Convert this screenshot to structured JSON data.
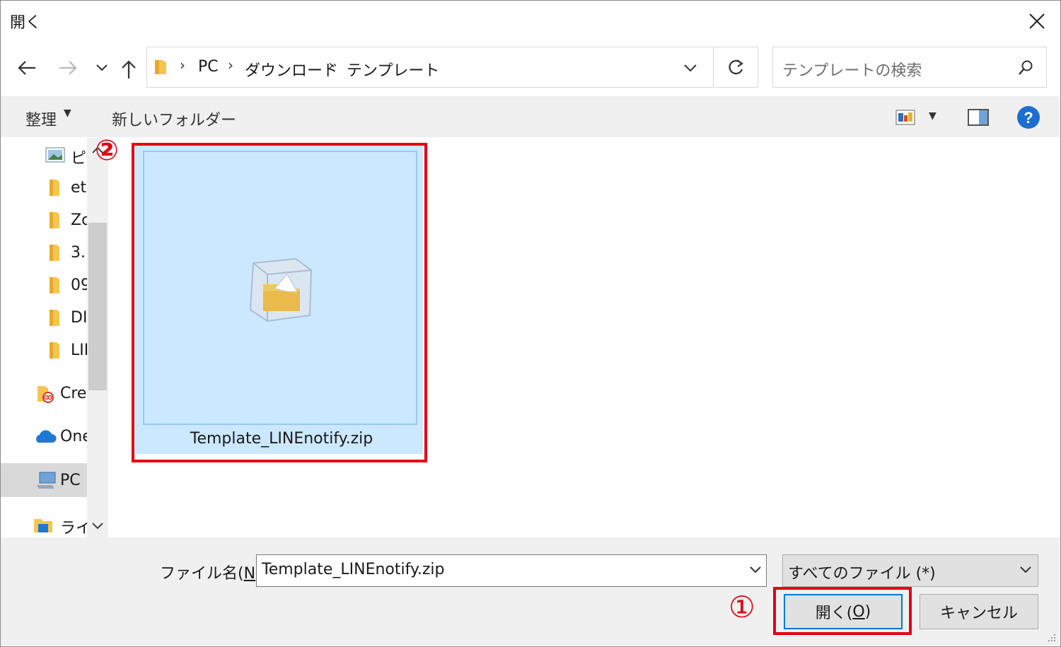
{
  "window": {
    "title": "開く",
    "close_icon": "close-icon"
  },
  "nav": {
    "back": "back-arrow-icon",
    "forward": "forward-arrow-icon",
    "recent": "chevron-down-icon",
    "up": "up-arrow-icon"
  },
  "address": {
    "crumbs": [
      "PC",
      "ダウンロード",
      "テンプレート"
    ]
  },
  "search": {
    "placeholder": "テンプレートの検索"
  },
  "toolbar": {
    "organize": "整理",
    "new_folder": "新しいフォルダー"
  },
  "navpane": {
    "items": [
      {
        "label": "ピ",
        "icon": "pictures-icon"
      },
      {
        "label": "et",
        "icon": "folder-icon"
      },
      {
        "label": "Zc",
        "icon": "folder-icon"
      },
      {
        "label": "3.",
        "icon": "folder-icon"
      },
      {
        "label": "09",
        "icon": "folder-icon"
      },
      {
        "label": "DI",
        "icon": "folder-icon"
      },
      {
        "label": "LII",
        "icon": "folder-icon"
      },
      {
        "label": "Cre",
        "icon": "creative-cloud-icon"
      },
      {
        "label": "One",
        "icon": "onedrive-icon"
      },
      {
        "label": "PC",
        "icon": "pc-icon"
      },
      {
        "label": "ライ",
        "icon": "library-icon"
      }
    ]
  },
  "files": [
    {
      "name": "Template_LINEnotify.zip",
      "icon": "zip-folder-icon",
      "selected": true
    }
  ],
  "annotations": {
    "marker1": "①",
    "marker2": "②",
    "color": "#e50012"
  },
  "bottom": {
    "filename_label": "ファイル名(",
    "filename_key": "N",
    "filename_label_end": "):",
    "filename_value": "Template_LINEnotify.zip",
    "filetype": "すべてのファイル (*)",
    "open_label": "開く(",
    "open_key": "O",
    "open_end": ")",
    "cancel_label": "キャンセル"
  },
  "colors": {
    "selection": "#cce8ff",
    "accent": "#0078d7",
    "help": "#1c6fd1"
  }
}
